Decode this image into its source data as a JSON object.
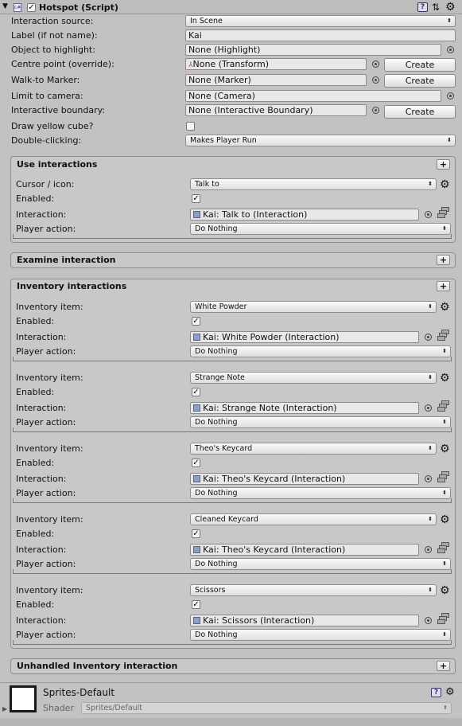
{
  "header": {
    "title": "Hotspot (Script)",
    "enabled": true
  },
  "main": {
    "interaction_source": {
      "label": "Interaction source:",
      "value": "In Scene"
    },
    "label_field": {
      "label": "Label (if not name):",
      "value": "Kai"
    },
    "object_highlight": {
      "label": "Object to highlight:",
      "value": "None (Highlight)"
    },
    "centre_point": {
      "label": "Centre point (override):",
      "value": "None (Transform)",
      "button": "Create"
    },
    "walk_to": {
      "label": "Walk-to Marker:",
      "value": "None (Marker)",
      "button": "Create"
    },
    "limit_camera": {
      "label": "Limit to camera:",
      "value": "None (Camera)"
    },
    "boundary": {
      "label": "Interactive boundary:",
      "value": "None (Interactive Boundary)",
      "button": "Create"
    },
    "yellow_cube": {
      "label": "Draw yellow cube?",
      "checked": false
    },
    "double_click": {
      "label": "Double-clicking:",
      "value": "Makes Player Run"
    }
  },
  "use_interactions": {
    "title": "Use interactions",
    "plus": "+",
    "cursor_label": "Cursor / icon:",
    "cursor_value": "Talk to",
    "enabled_label": "Enabled:",
    "enabled": true,
    "interaction_label": "Interaction:",
    "interaction_value": "Kai: Talk to (Interaction)",
    "player_action_label": "Player action:",
    "player_action_value": "Do Nothing"
  },
  "examine": {
    "title": "Examine interaction",
    "plus": "+"
  },
  "inventory": {
    "title": "Inventory interactions",
    "plus": "+",
    "item_label": "Inventory item:",
    "enabled_label": "Enabled:",
    "interaction_label": "Interaction:",
    "player_action_label": "Player action:",
    "items": [
      {
        "item": "White Powder",
        "enabled": true,
        "interaction": "Kai: White Powder (Interaction)",
        "player_action": "Do Nothing"
      },
      {
        "item": "Strange Note",
        "enabled": true,
        "interaction": "Kai: Strange Note (Interaction)",
        "player_action": "Do Nothing"
      },
      {
        "item": "Theo's Keycard",
        "enabled": true,
        "interaction": "Kai: Theo's Keycard (Interaction)",
        "player_action": "Do Nothing"
      },
      {
        "item": "Cleaned Keycard",
        "enabled": true,
        "interaction": "Kai: Theo's Keycard (Interaction)",
        "player_action": "Do Nothing"
      },
      {
        "item": "Scissors",
        "enabled": true,
        "interaction": "Kai: Scissors (Interaction)",
        "player_action": "Do Nothing"
      }
    ]
  },
  "unhandled": {
    "title": "Unhandled Inventory interaction",
    "plus": "+"
  },
  "material": {
    "name": "Sprites-Default",
    "shader_label": "Shader",
    "shader_value": "Sprites/Default"
  }
}
